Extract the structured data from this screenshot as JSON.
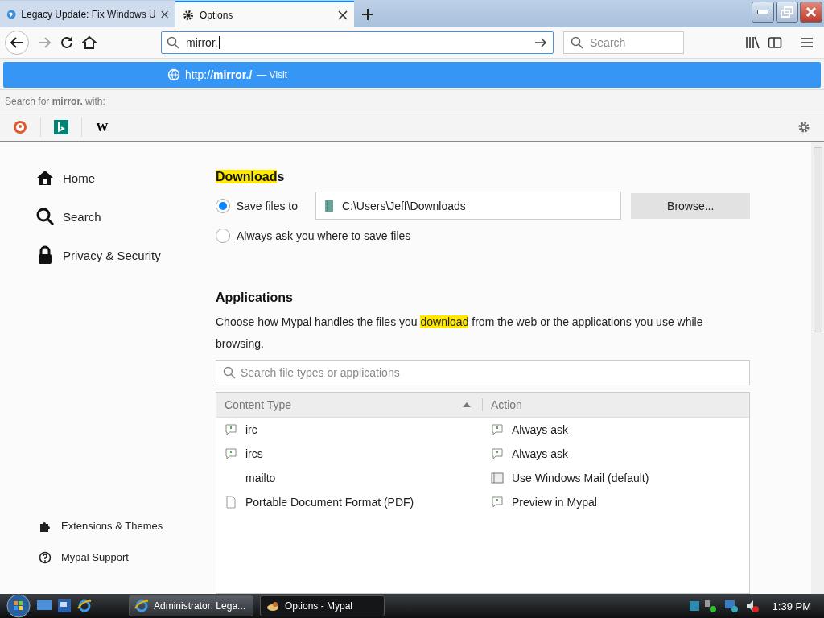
{
  "tabs": [
    {
      "title": "Legacy Update: Fix Windows U",
      "selected": false
    },
    {
      "title": "Options",
      "selected": true
    }
  ],
  "url_field": {
    "value": "mirror."
  },
  "search_field": {
    "placeholder": "Search"
  },
  "url_popup": {
    "url": "http://**mirror./**",
    "action": "— Visit",
    "search_hint": "Search for **mirror.** with:",
    "engines": [
      {
        "kind": "duck"
      },
      {
        "kind": "bing"
      },
      {
        "kind": "wiki",
        "label": "W"
      }
    ]
  },
  "sidebar": {
    "items": [
      {
        "label": "Home"
      },
      {
        "label": "Search"
      },
      {
        "label": "Privacy & Security"
      }
    ],
    "footer": [
      {
        "label": "Extensions & Themes"
      },
      {
        "label": "Mypal Support"
      }
    ]
  },
  "downloads": {
    "heading": [
      {
        "text": "Download",
        "highlighted": true
      },
      {
        "text": "s",
        "highlighted": false
      }
    ],
    "options": [
      {
        "label": "Save files to",
        "selected": true
      },
      {
        "label": "Always ask you where to save files",
        "selected": false
      }
    ],
    "folder": "C:\\Users\\Jeff\\Downloads",
    "browse": "Browse..."
  },
  "applications": {
    "heading": "Applications",
    "description": [
      {
        "text": "Choose how Mypal handles the files you ",
        "highlighted": false
      },
      {
        "text": "download",
        "highlighted": true
      },
      {
        "text": " from the web or the applications you use while browsing.",
        "highlighted": false
      }
    ],
    "filter": {
      "placeholder": "Search file types or applications"
    },
    "columns": [
      "Content Type",
      "Action"
    ],
    "rows": [
      {
        "type": "irc",
        "action": "Always ask"
      },
      {
        "type": "ircs",
        "action": "Always ask"
      },
      {
        "type": "mailto",
        "action": "Use Windows Mail (default)"
      },
      {
        "type": "Portable Document Format (PDF)",
        "action": "Preview in Mypal"
      }
    ]
  },
  "taskbar": {
    "tasks": [
      {
        "label": "Administrator: Lega...",
        "selected": false
      },
      {
        "label": "Options - Mypal",
        "selected": true
      }
    ],
    "clock": "1:39 PM"
  }
}
